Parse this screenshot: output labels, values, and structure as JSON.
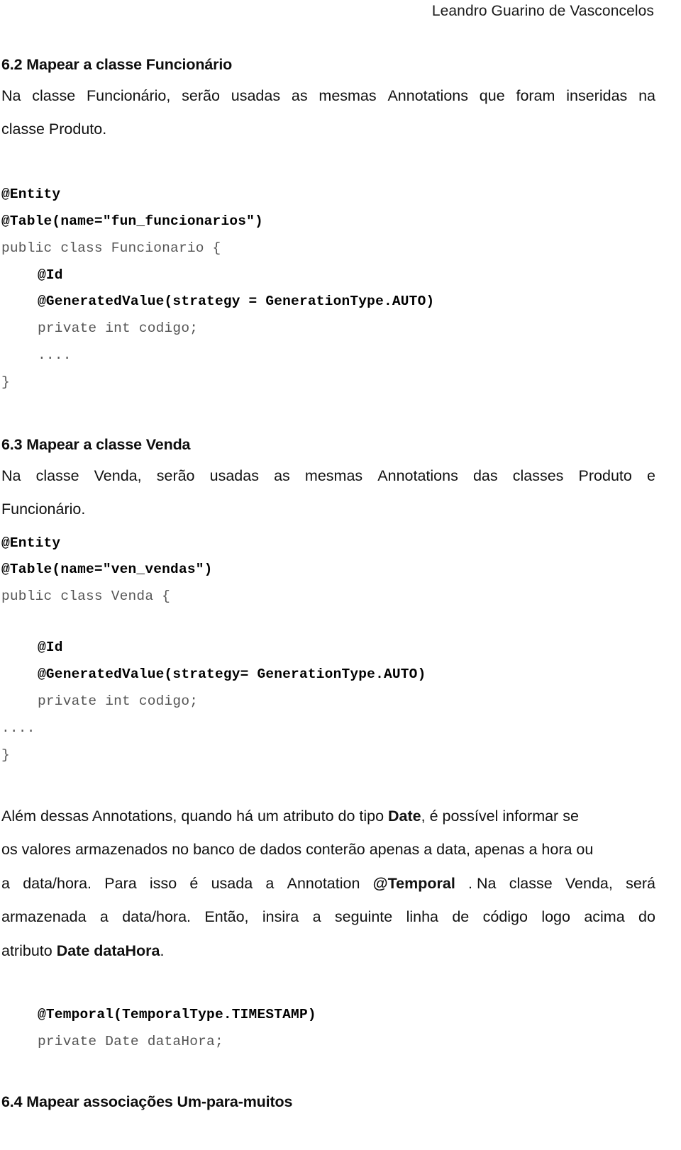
{
  "header": {
    "author": "Leandro Guarino de Vasconcelos"
  },
  "sections": {
    "s62": {
      "heading": "6.2 Mapear a classe Funcionário",
      "paragraph_lines": [
        [
          "Na",
          "classe",
          "Funcionário,",
          "serão",
          "usadas",
          "as",
          "mesmas",
          "Annotations",
          "que",
          "foram",
          "inseridas",
          "na"
        ],
        [
          "classe Produto."
        ]
      ],
      "code": [
        {
          "text": "@Entity",
          "bold": true,
          "indent": 0
        },
        {
          "text": "@Table(name=\"fun_funcionarios\")",
          "bold": true,
          "indent": 0
        },
        {
          "text": "public class Funcionario {",
          "bold": false,
          "indent": 0
        },
        {
          "text": "@Id",
          "bold": true,
          "indent": 1
        },
        {
          "text": "@GeneratedValue(strategy = GenerationType.AUTO)",
          "bold": true,
          "indent": 1
        },
        {
          "text": "private int codigo;",
          "bold": false,
          "indent": 1
        },
        {
          "text": "....",
          "bold": false,
          "indent": 1
        },
        {
          "text": "}",
          "bold": false,
          "indent": 0
        }
      ]
    },
    "s63": {
      "heading": "6.3 Mapear a classe Venda",
      "paragraph_lines": [
        [
          "Na",
          "classe",
          "Venda,",
          "serão",
          "usadas",
          "as",
          "mesmas",
          "Annotations",
          "das",
          "classes",
          "Produto",
          "e"
        ],
        [
          "Funcionário."
        ]
      ],
      "code": [
        {
          "text": "@Entity",
          "bold": true,
          "indent": 0
        },
        {
          "text": "@Table(name=\"ven_vendas\")",
          "bold": true,
          "indent": 0
        },
        {
          "text": "public class Venda {",
          "bold": false,
          "indent": 0
        },
        {
          "text": "@Id",
          "bold": true,
          "indent": 1
        },
        {
          "text": "@GeneratedValue(strategy= GenerationType.AUTO)",
          "bold": true,
          "indent": 1
        },
        {
          "text": "private int codigo;",
          "bold": false,
          "indent": 1
        },
        {
          "text": "....",
          "bold": false,
          "indent": 0
        },
        {
          "text": "}",
          "bold": false,
          "indent": 0
        }
      ],
      "temporal_paragraph": {
        "line1": [
          "Além dessas Annotations, quando há um atributo do tipo ",
          "Date",
          ", é possível informar se"
        ],
        "line2": [
          "os valores armazenados no banco de dados conterão apenas a data, apenas a hora ou"
        ],
        "line3_pre": [
          "a",
          "data/hora.",
          "Para",
          "isso",
          "é",
          "usada",
          "a",
          "Annotation"
        ],
        "line3_bold": "@Temporal",
        "line3_post": [
          ". Na",
          "classe",
          "Venda,",
          "será"
        ],
        "line4": [
          "armazenada",
          "a",
          "data/hora.",
          "Então,",
          "insira",
          "a",
          "seguinte",
          "linha",
          "de",
          "código",
          "logo",
          "acima",
          "do"
        ],
        "line5_pre": "atributo ",
        "line5_bold": "Date dataHora",
        "line5_post": "."
      },
      "temporal_code": [
        {
          "text": "@Temporal(TemporalType.TIMESTAMP)",
          "bold": true,
          "indent": 1
        },
        {
          "text": "private Date dataHora;",
          "bold": false,
          "indent": 1
        }
      ]
    },
    "s64": {
      "heading": "6.4 Mapear associações Um-para-muitos"
    }
  }
}
